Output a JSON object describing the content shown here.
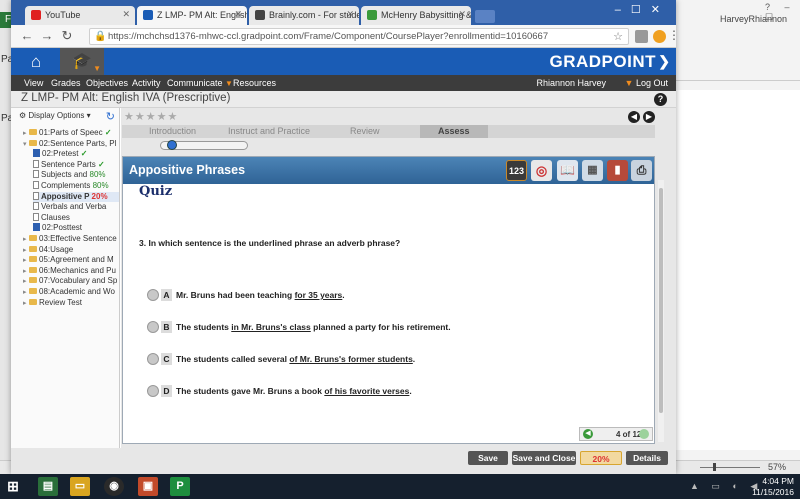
{
  "background_word": {
    "user_name": "HarveyRhiannon",
    "para_label": "Pa",
    "zoom_percent": "57%",
    "window_controls": "? – ☐"
  },
  "browser": {
    "tabs": [
      {
        "title": "YouTube",
        "active": false
      },
      {
        "title": "Z LMP- PM Alt: English I",
        "active": true
      },
      {
        "title": "Brainly.com - For studen",
        "active": false
      },
      {
        "title": "McHenry Babysitting & ",
        "active": false
      }
    ],
    "url": "https://mchchsd1376-mhwc-ccl.gradpoint.com/Frame/Component/CoursePlayer?enrollmentid=10160667"
  },
  "gradpoint": {
    "brand": "GRADPOINT",
    "nav": [
      "View",
      "Grades",
      "Objectives",
      "Activity",
      "Communicate",
      "Resources"
    ],
    "user": "Rhiannon Harvey",
    "logout": "Log Out",
    "course_title": "Z LMP- PM Alt: English IVA (Prescriptive)",
    "display_options": "Display Options",
    "phase_tabs": [
      "Introduction",
      "Instruct and Practice",
      "Review",
      "Assess"
    ],
    "active_phase": "Assess",
    "progress_fraction": 0.1
  },
  "sidebar": {
    "items": [
      {
        "label": "01:Parts of Speec",
        "type": "folder",
        "status": "✓",
        "level": 0
      },
      {
        "label": "02:Sentence Parts, Pl",
        "type": "folder",
        "status": "",
        "level": 0
      },
      {
        "label": "02:Pretest",
        "type": "quiz",
        "status": "✓",
        "level": 1
      },
      {
        "label": "Sentence Parts",
        "type": "doc",
        "status": "✓",
        "level": 1
      },
      {
        "label": "Subjects and",
        "type": "doc",
        "status": "80%",
        "level": 1
      },
      {
        "label": "Complements",
        "type": "doc",
        "status": "80%",
        "level": 1
      },
      {
        "label": "Appositive P",
        "type": "doc",
        "status": "20%",
        "level": 1,
        "selected": true
      },
      {
        "label": "Verbals and Verba",
        "type": "doc",
        "status": "",
        "level": 1
      },
      {
        "label": "Clauses",
        "type": "doc",
        "status": "",
        "level": 1
      },
      {
        "label": "02:Posttest",
        "type": "quiz",
        "status": "",
        "level": 1
      },
      {
        "label": "03:Effective Sentence",
        "type": "folder",
        "status": "",
        "level": 0
      },
      {
        "label": "04:Usage",
        "type": "folder",
        "status": "",
        "level": 0
      },
      {
        "label": "05:Agreement and M",
        "type": "folder",
        "status": "",
        "level": 0
      },
      {
        "label": "06:Mechanics and Pu",
        "type": "folder",
        "status": "",
        "level": 0
      },
      {
        "label": "07:Vocabulary and Sp",
        "type": "folder",
        "status": "",
        "level": 0
      },
      {
        "label": "08:Academic and Wo",
        "type": "folder",
        "status": "",
        "level": 0
      },
      {
        "label": "Review Test",
        "type": "folder",
        "status": "",
        "level": 0
      }
    ]
  },
  "lesson": {
    "title": "Appositive Phrases",
    "quiz_heading": "Quiz",
    "question_number": "3.",
    "question": "In which sentence is the underlined phrase an adverb phrase?",
    "answers": [
      {
        "letter": "A",
        "before": "Mr. Bruns had been teaching ",
        "underlined": "for 35 years",
        "after": "."
      },
      {
        "letter": "B",
        "before": "The students ",
        "underlined": "in Mr. Bruns's class",
        "after": " planned a party for his retirement."
      },
      {
        "letter": "C",
        "before": "The students called several ",
        "underlined": "of Mr. Bruns's former students",
        "after": "."
      },
      {
        "letter": "D",
        "before": "The students gave Mr. Bruns a book ",
        "underlined": "of his favorite verses",
        "after": "."
      }
    ],
    "counter": "4 of 12",
    "tools": [
      "calculator-icon",
      "target-icon",
      "book-icon",
      "map-icon",
      "dictionary-icon",
      "printer-icon"
    ],
    "tool_labels": [
      "123",
      "",
      "",
      "",
      "",
      ""
    ]
  },
  "footer": {
    "save": "Save",
    "save_close": "Save and Close",
    "score": "20%",
    "details": "Details"
  },
  "taskbar": {
    "time": "4:04 PM",
    "date": "11/15/2016"
  },
  "colors": {
    "gp_blue": "#1a5cb5",
    "nav_dark": "#3c3c3c",
    "lesson_bar": "#3a71a6",
    "accent_orange": "#f08c1e"
  }
}
